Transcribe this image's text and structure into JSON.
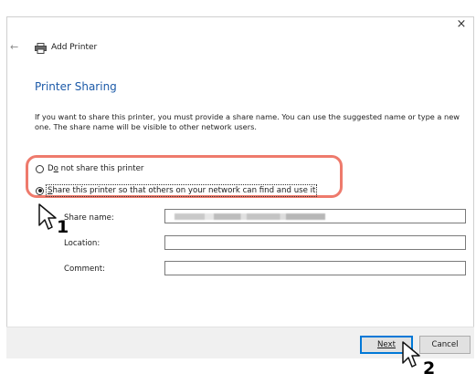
{
  "window": {
    "close_label": "×",
    "back_label": "←",
    "title": "Add Printer"
  },
  "page": {
    "heading": "Printer Sharing",
    "description": "If you want to share this printer, you must provide a share name. You can use the suggested name or type a new one. The share name will be visible to other network users."
  },
  "options": [
    {
      "label_prefix": "D",
      "label_accel": "o",
      "label_suffix": " not share this printer",
      "checked": false
    },
    {
      "label_prefix": "",
      "label_accel": "S",
      "label_suffix": "hare this printer so that others on your network can find and use it",
      "checked": true
    }
  ],
  "fields": {
    "share_name_label": "Share name:",
    "location_label": "Location:",
    "comment_label": "Comment:",
    "share_name_value": "",
    "location_value": "",
    "comment_value": ""
  },
  "buttons": {
    "next_label": "Next",
    "cancel_label": "Cancel"
  },
  "callouts": {
    "step1": "1",
    "step2": "2"
  },
  "colors": {
    "heading": "#1c5aa8",
    "highlight": "#ee7a6c",
    "primary_border": "#0078d7"
  }
}
